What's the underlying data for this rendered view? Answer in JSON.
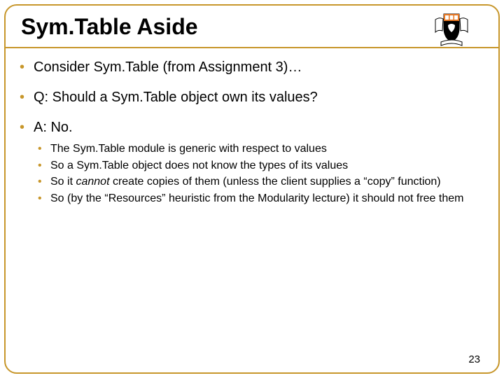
{
  "title": "Sym.Table Aside",
  "bullets": {
    "b1": "Consider Sym.Table (from Assignment 3)…",
    "b2": "Q: Should a Sym.Table object own its values?",
    "b3": "A: No.",
    "sub": {
      "s1": "The Sym.Table module is generic with respect to values",
      "s2": "So a Sym.Table object does not know the types of its values",
      "s3a": "So it ",
      "s3b": "cannot ",
      "s3c": "create copies of them (unless the client supplies a “copy” function)",
      "s4": "So (by the “Resources” heuristic from the Modularity lecture) it should not free them"
    }
  },
  "page_number": "23",
  "logo_name": "princeton-shield"
}
